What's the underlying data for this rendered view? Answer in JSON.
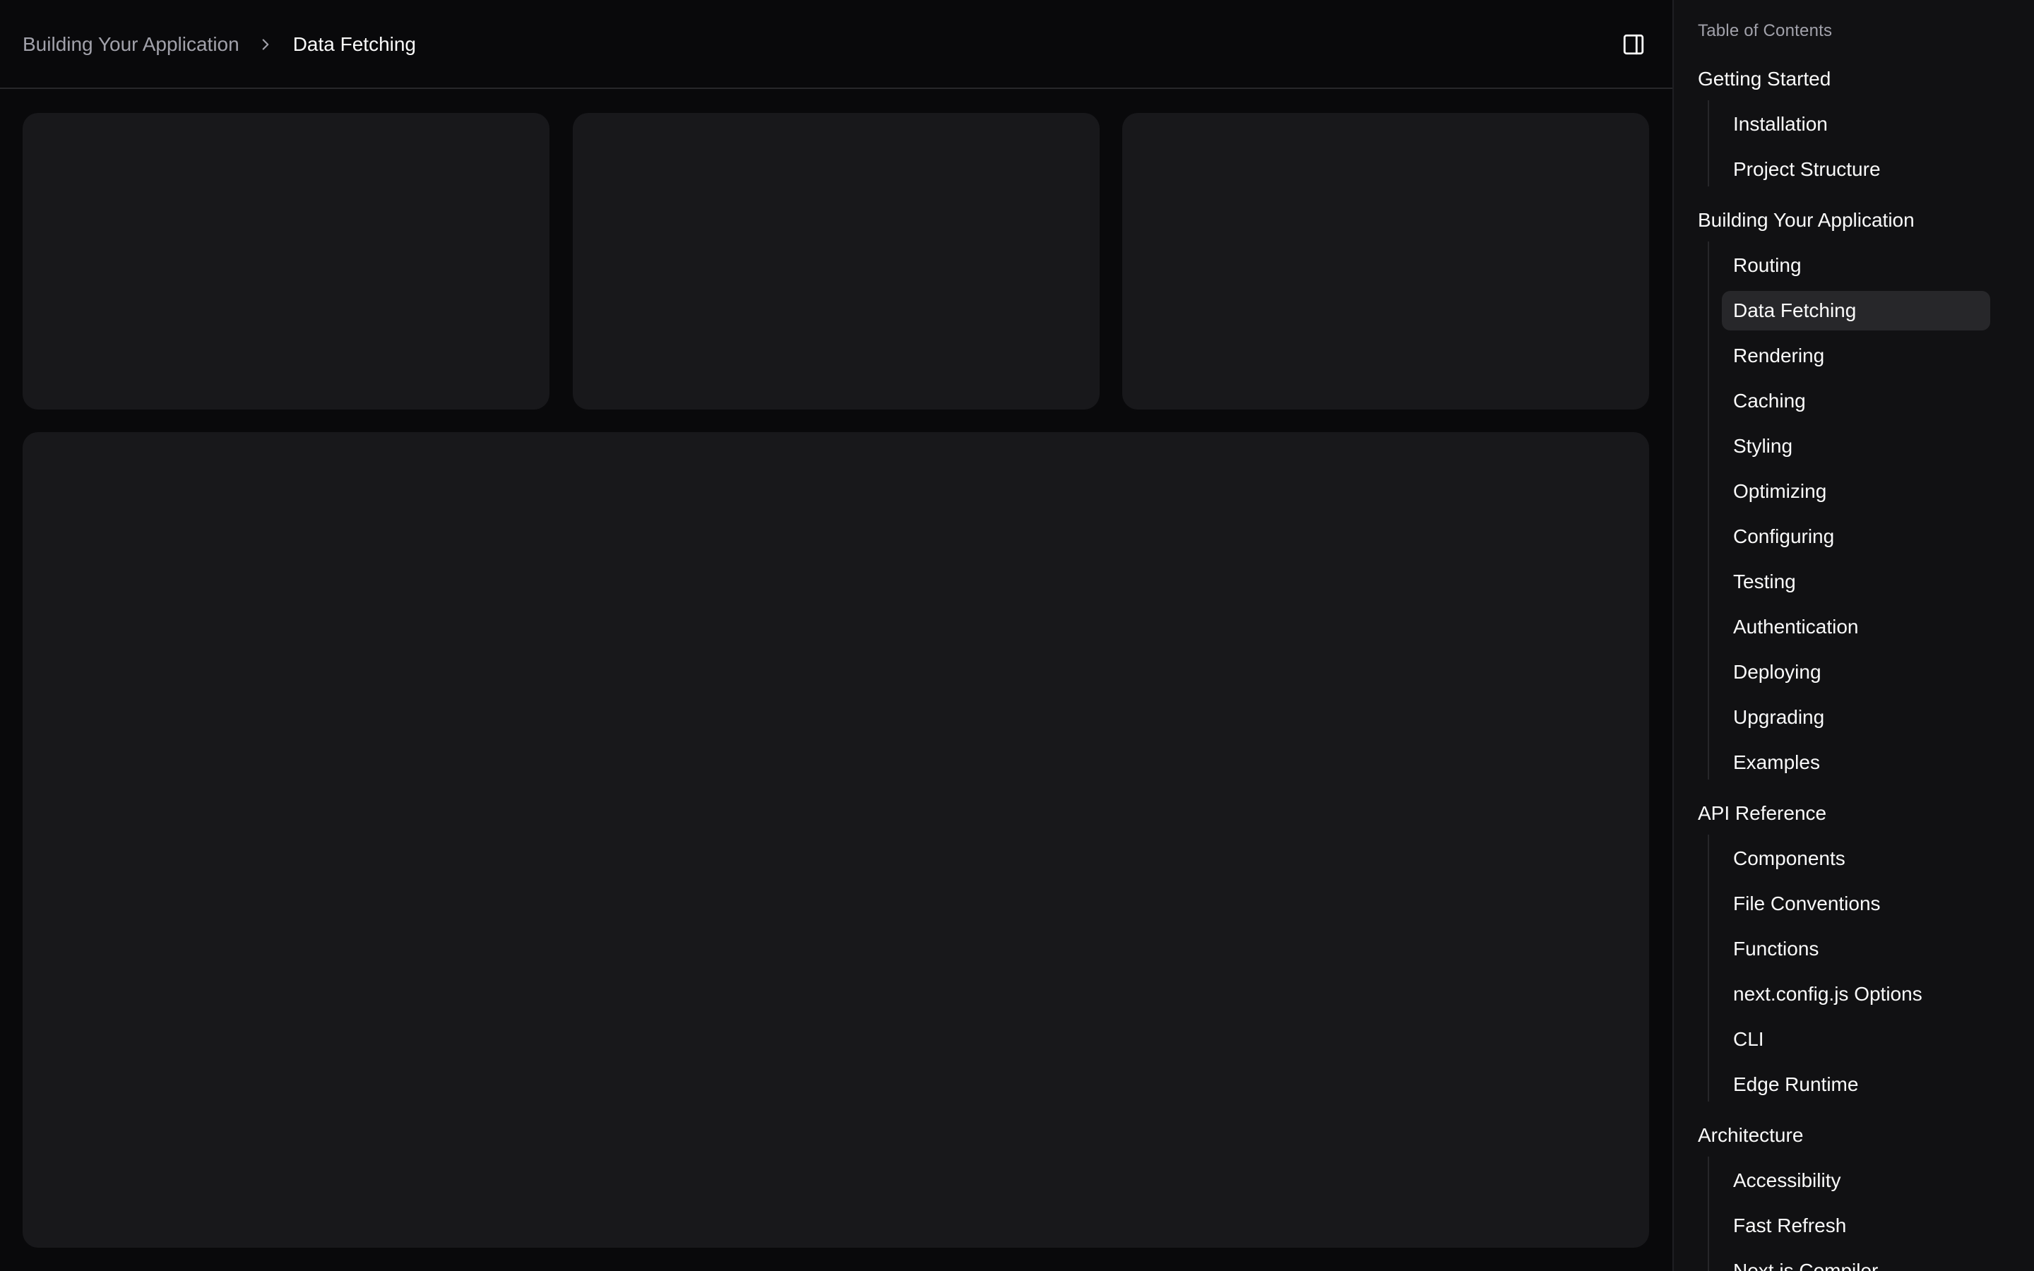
{
  "header": {
    "breadcrumb_parent": "Building Your Application",
    "breadcrumb_current": "Data Fetching",
    "separator_icon": "chevron-right-icon",
    "panel_toggle_icon": "panel-right-icon"
  },
  "sidebar": {
    "title": "Table of Contents",
    "sections": [
      {
        "title": "Getting Started",
        "items": [
          "Installation",
          "Project Structure"
        ]
      },
      {
        "title": "Building Your Application",
        "items": [
          "Routing",
          "Data Fetching",
          "Rendering",
          "Caching",
          "Styling",
          "Optimizing",
          "Configuring",
          "Testing",
          "Authentication",
          "Deploying",
          "Upgrading",
          "Examples"
        ]
      },
      {
        "title": "API Reference",
        "items": [
          "Components",
          "File Conventions",
          "Functions",
          "next.config.js Options",
          "CLI",
          "Edge Runtime"
        ]
      },
      {
        "title": "Architecture",
        "items": [
          "Accessibility",
          "Fast Refresh",
          "Next.js Compiler"
        ]
      }
    ],
    "active_item": "Data Fetching"
  },
  "colors": {
    "background": "#09090b",
    "card": "#18181b",
    "sidebar": "#111113",
    "active_item": "#27272a",
    "muted_text": "#a1a1aa",
    "text": "#fafafa"
  }
}
